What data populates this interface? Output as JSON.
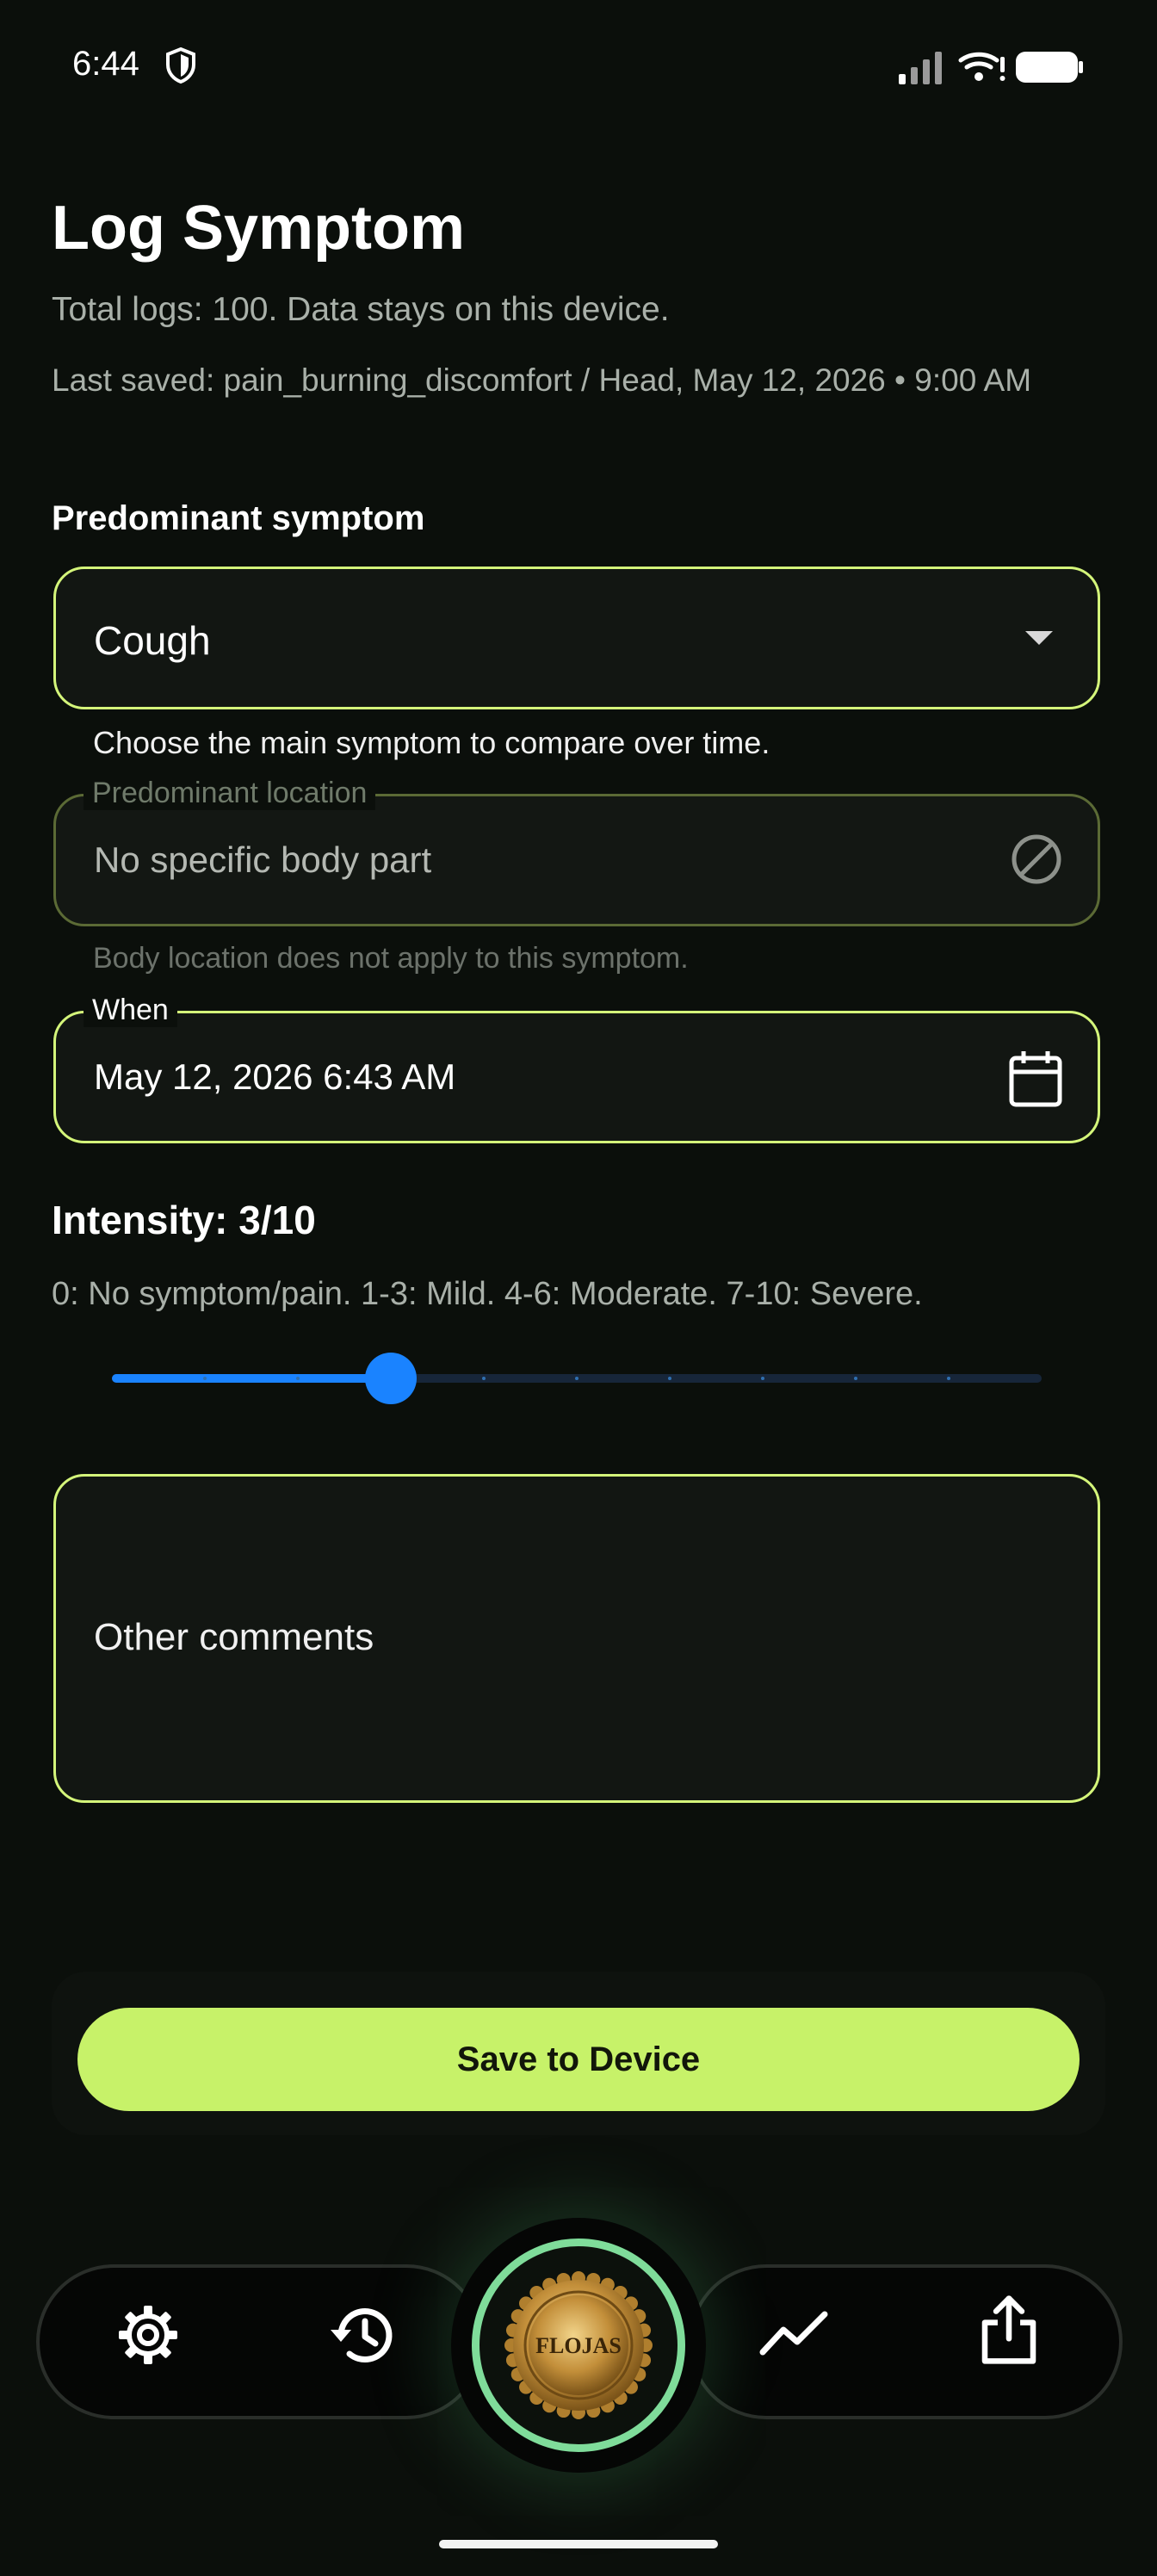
{
  "status_bar": {
    "time": "6:44"
  },
  "header": {
    "title": "Log Symptom",
    "total_logs": "Total logs: 100. Data stays on this device.",
    "last_saved": "Last saved: pain_burning_discomfort / Head, May 12, 2026 • 9:00 AM"
  },
  "symptom": {
    "section_label": "Predominant symptom",
    "value": "Cough",
    "helper": "Choose the main symptom to compare over time."
  },
  "location": {
    "label": "Predominant location",
    "value": "No specific body part",
    "helper": "Body location does not apply to this symptom."
  },
  "when": {
    "label": "When",
    "value": "May 12, 2026 6:43 AM"
  },
  "intensity": {
    "label": "Intensity: 3/10",
    "help": "0: No symptom/pain. 1-3: Mild. 4-6: Moderate. 7-10: Severe.",
    "value": 3,
    "min": 0,
    "max": 10
  },
  "comments": {
    "placeholder": "Other comments"
  },
  "save_button": {
    "label": "Save to Device"
  },
  "logo": {
    "text": "FLOJAS"
  },
  "bottom_nav": {
    "icons": [
      "gear-icon",
      "history-icon",
      "trend-icon",
      "share-icon"
    ]
  },
  "colors": {
    "accent": "#c7f269",
    "slider": "#1a83ff",
    "background": "#0b0f0b"
  }
}
